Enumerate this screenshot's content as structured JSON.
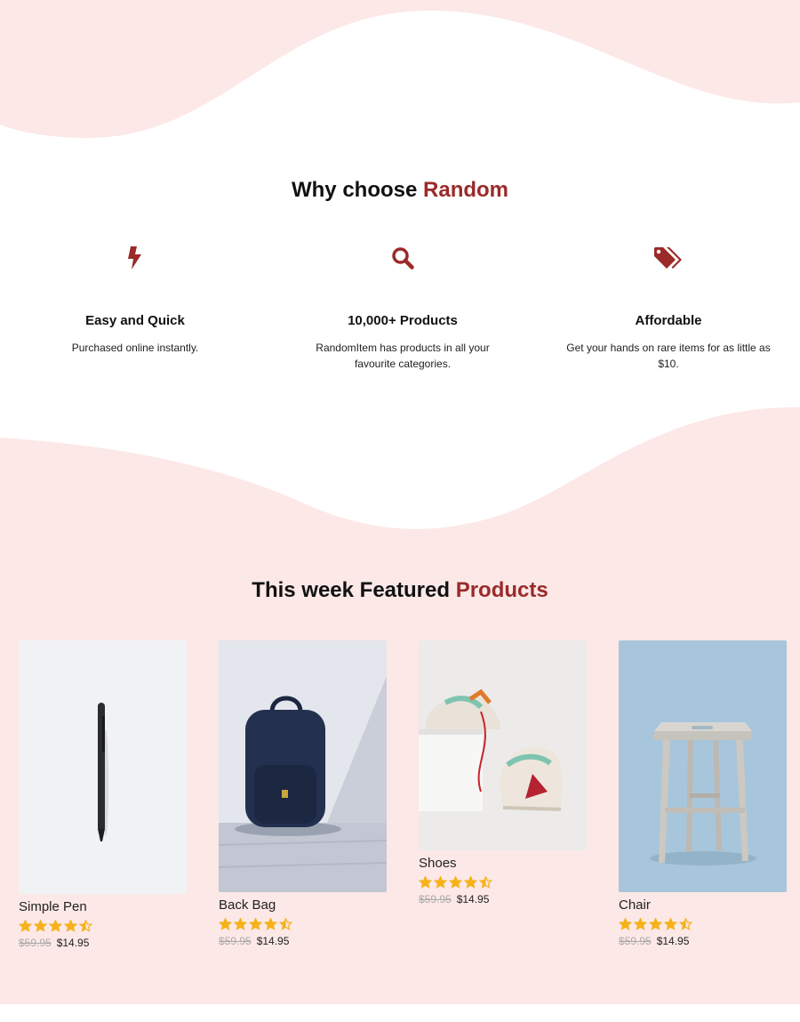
{
  "colors": {
    "accent": "#9b2a2a",
    "pink_bg": "#fce8e7",
    "star": "#f5b21d"
  },
  "why": {
    "title_prefix": "Why choose ",
    "title_accent": "Random",
    "features": [
      {
        "icon": "bolt-icon",
        "title": "Easy and Quick",
        "desc": "Purchased online instantly."
      },
      {
        "icon": "search-icon",
        "title": "10,000+ Products",
        "desc": "RandomItem has products in all your favourite categories."
      },
      {
        "icon": "tags-icon",
        "title": "Affordable",
        "desc": "Get your hands on rare items for as little as $10."
      }
    ]
  },
  "featured": {
    "title_prefix": "This week Featured ",
    "title_accent": "Products",
    "products": [
      {
        "name": "Simple Pen",
        "rating": 4.5,
        "old_price": "$59.95",
        "price": "$14.95",
        "image": "pen-photo"
      },
      {
        "name": "Back Bag",
        "rating": 4.5,
        "old_price": "$59.95",
        "price": "$14.95",
        "image": "backpack-photo"
      },
      {
        "name": "Shoes",
        "rating": 4.5,
        "old_price": "$59.95",
        "price": "$14.95",
        "image": "sneakers-photo"
      },
      {
        "name": "Chair",
        "rating": 4.5,
        "old_price": "$59.95",
        "price": "$14.95",
        "image": "stool-photo"
      }
    ]
  }
}
